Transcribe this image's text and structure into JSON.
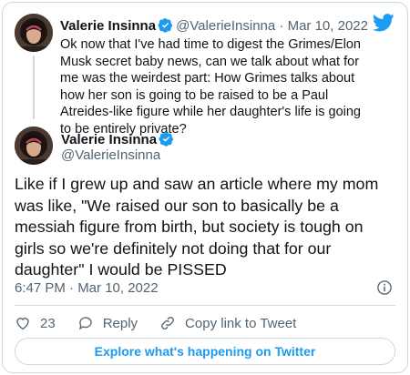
{
  "icons": {
    "brand": "twitter-bird-icon",
    "verified": "verified-badge-icon",
    "info": "info-icon",
    "like": "heart-icon",
    "reply": "reply-bubble-icon",
    "copy_link": "link-icon"
  },
  "colors": {
    "accent": "#1d9bf0",
    "text": "#0f1419",
    "muted": "#536471",
    "border": "#cfd9de"
  },
  "parent_tweet": {
    "name": "Valerie Insinna",
    "handle": "@ValerieInsinna",
    "separator": "·",
    "date": "Mar 10, 2022",
    "text": "Ok now that I've had time to digest the Grimes/Elon Musk secret baby news, can we talk about what for me was the weirdest part: How Grimes talks about how her son is going to be raised to be a Paul Atreides-like figure while her daughter's life is going to be entirely private?"
  },
  "tweet": {
    "name": "Valerie Insinna",
    "handle": "@ValerieInsinna",
    "text": "Like if I grew up and saw an article where my mom was like, \"We raised our son to basically be a messiah figure from birth, but society is tough on girls so we're definitely not doing that for our daughter\" I would be PISSED",
    "timestamp": "6:47 PM · Mar 10, 2022"
  },
  "actions": {
    "like_count": "23",
    "reply_label": "Reply",
    "copy_link_label": "Copy link to Tweet"
  },
  "explore_label": "Explore what's happening on Twitter"
}
